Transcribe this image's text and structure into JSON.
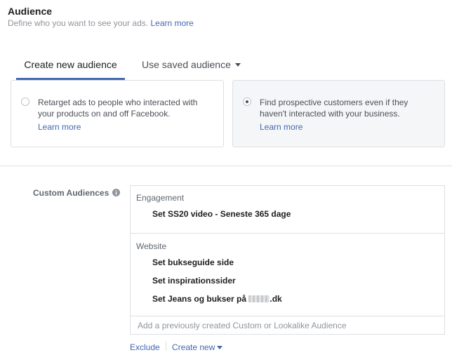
{
  "section": {
    "title": "Audience",
    "subtitle": "Define who you want to see your ads.",
    "learn_more": "Learn more"
  },
  "tabs": {
    "create": "Create new audience",
    "saved": "Use saved audience"
  },
  "options": {
    "retarget": {
      "text": "Retarget ads to people who interacted with your products on and off Facebook.",
      "link": "Learn more"
    },
    "prospect": {
      "text": "Find prospective customers even if they haven't interacted with your business.",
      "link": "Learn more"
    }
  },
  "custom_audiences": {
    "label": "Custom Audiences",
    "groups": {
      "engagement": {
        "title": "Engagement",
        "items": [
          "Set SS20 video - Seneste 365 dage"
        ]
      },
      "website": {
        "title": "Website",
        "items": [
          "Set bukseguide side",
          "Set inspirationssider"
        ],
        "last_prefix": "Set Jeans og bukser på ",
        "last_suffix": ".dk"
      }
    },
    "placeholder": "Add a previously created Custom or Lookalike Audience",
    "exclude": "Exclude",
    "create_new": "Create new"
  },
  "colors": {
    "accent": "#4267b2",
    "border": "#dddfe2",
    "muted": "#90949c"
  }
}
